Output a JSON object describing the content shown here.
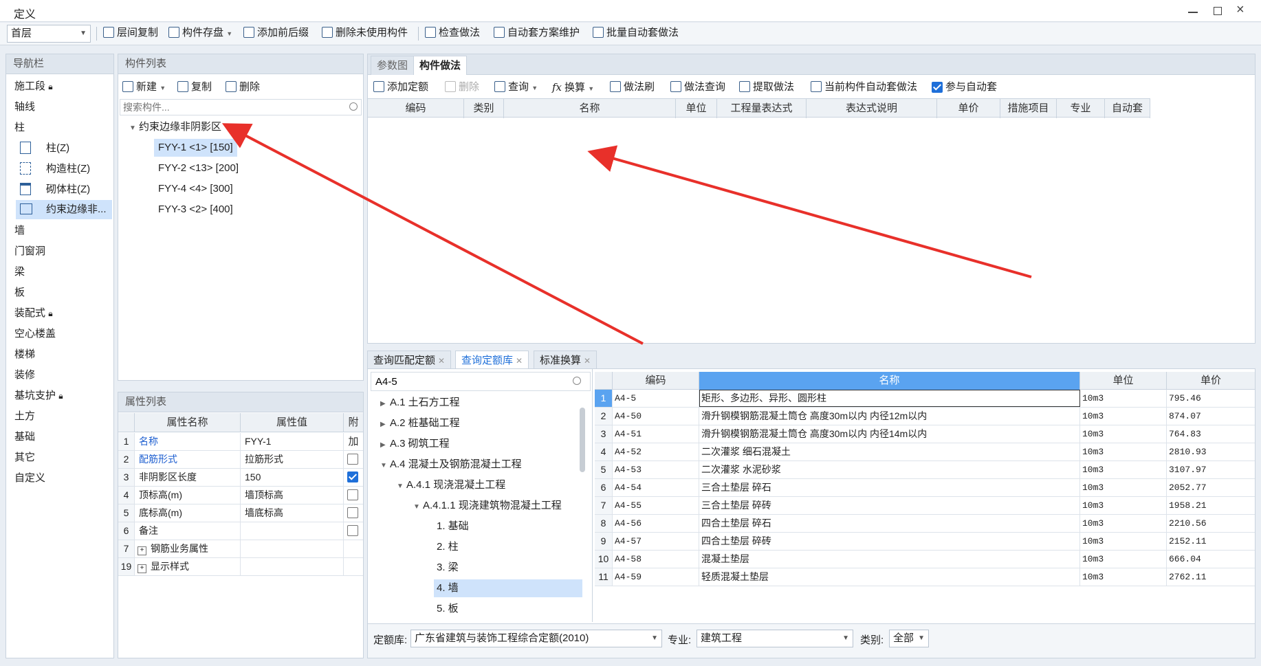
{
  "window": {
    "title": "定义"
  },
  "toolbar": {
    "floor_select": "首层",
    "items": [
      "层间复制",
      "构件存盘",
      "添加前后缀",
      "删除未使用构件",
      "检查做法",
      "自动套方案维护",
      "批量自动套做法"
    ]
  },
  "nav": {
    "title": "导航栏",
    "items": [
      "施工段",
      "轴线",
      "柱",
      "墙",
      "门窗洞",
      "梁",
      "板",
      "装配式",
      "空心楼盖",
      "楼梯",
      "装修",
      "基坑支护",
      "土方",
      "基础",
      "其它",
      "自定义"
    ],
    "sub_items": [
      "柱(Z)",
      "构造柱(Z)",
      "砌体柱(Z)",
      "约束边缘非..."
    ]
  },
  "component_list": {
    "title": "构件列表",
    "new_label": "新建",
    "copy_label": "复制",
    "delete_label": "删除",
    "search_placeholder": "搜索构件...",
    "group": "约束边缘非阴影区",
    "items": [
      "FYY-1 <1> [150]",
      "FYY-2 <13> [200]",
      "FYY-4 <4> [300]",
      "FYY-3 <2> [400]"
    ]
  },
  "properties": {
    "title": "属性列表",
    "headers": [
      "属性名称",
      "属性值",
      "附加"
    ],
    "rows": [
      {
        "no": "1",
        "name": "名称",
        "value": "FYY-1",
        "check": "none"
      },
      {
        "no": "2",
        "name": "配筋形式",
        "value": "拉筋形式",
        "check": "off"
      },
      {
        "no": "3",
        "name": "非阴影区长度",
        "value": "150",
        "check": "on"
      },
      {
        "no": "4",
        "name": "顶标高(m)",
        "value": "墙顶标高",
        "check": "off"
      },
      {
        "no": "5",
        "name": "底标高(m)",
        "value": "墙底标高",
        "check": "off"
      },
      {
        "no": "6",
        "name": "备注",
        "value": "",
        "check": "off"
      },
      {
        "no": "7",
        "name": "钢筋业务属性",
        "value": "",
        "check": "none"
      },
      {
        "no": "19",
        "name": "显示样式",
        "value": "",
        "check": "none"
      }
    ]
  },
  "method": {
    "tabs": [
      "参数图",
      "构件做法"
    ],
    "toolbar": [
      "添加定额",
      "删除",
      "查询",
      "换算",
      "做法刷",
      "做法查询",
      "提取做法",
      "当前构件自动套做法",
      "参与自动套"
    ],
    "headers": [
      "编码",
      "类别",
      "名称",
      "单位",
      "工程量表达式",
      "表达式说明",
      "单价",
      "措施项目",
      "专业",
      "自动套"
    ]
  },
  "query": {
    "tabs": [
      "查询匹配定额",
      "查询定额库",
      "标准换算"
    ],
    "search_value": "A4-5",
    "tree": [
      {
        "label": "A.1 土石方工程",
        "level": 0,
        "caret": "right"
      },
      {
        "label": "A.2 桩基础工程",
        "level": 0,
        "caret": "right"
      },
      {
        "label": "A.3 砌筑工程",
        "level": 0,
        "caret": "right"
      },
      {
        "label": "A.4 混凝土及钢筋混凝土工程",
        "level": 0,
        "caret": "down"
      },
      {
        "label": "A.4.1 现浇混凝土工程",
        "level": 1,
        "caret": "down"
      },
      {
        "label": "A.4.1.1 现浇建筑物混凝土工程",
        "level": 2,
        "caret": "down"
      },
      {
        "label": "1. 基础",
        "level": 3,
        "caret": "none"
      },
      {
        "label": "2. 柱",
        "level": 3,
        "caret": "none"
      },
      {
        "label": "3. 梁",
        "level": 3,
        "caret": "none"
      },
      {
        "label": "4. 墙",
        "level": 3,
        "caret": "none"
      },
      {
        "label": "5. 板",
        "level": 3,
        "caret": "none"
      }
    ],
    "headers": [
      "编码",
      "名称",
      "单位",
      "单价"
    ],
    "rows": [
      {
        "no": "1",
        "code": "A4-5",
        "name": "矩形、多边形、异形、圆形柱",
        "unit": "10m3",
        "price": "795.46"
      },
      {
        "no": "2",
        "code": "A4-50",
        "name": "滑升钢模钢筋混凝土筒仓 高度30m以内 内径12m以内",
        "unit": "10m3",
        "price": "874.07"
      },
      {
        "no": "3",
        "code": "A4-51",
        "name": "滑升钢模钢筋混凝土筒仓 高度30m以内 内径14m以内",
        "unit": "10m3",
        "price": "764.83"
      },
      {
        "no": "4",
        "code": "A4-52",
        "name": "二次灌浆 细石混凝土",
        "unit": "10m3",
        "price": "2810.93"
      },
      {
        "no": "5",
        "code": "A4-53",
        "name": "二次灌浆 水泥砂浆",
        "unit": "10m3",
        "price": "3107.97"
      },
      {
        "no": "6",
        "code": "A4-54",
        "name": "三合土垫层 碎石",
        "unit": "10m3",
        "price": "2052.77"
      },
      {
        "no": "7",
        "code": "A4-55",
        "name": "三合土垫层 碎砖",
        "unit": "10m3",
        "price": "1958.21"
      },
      {
        "no": "8",
        "code": "A4-56",
        "name": "四合土垫层 碎石",
        "unit": "10m3",
        "price": "2210.56"
      },
      {
        "no": "9",
        "code": "A4-57",
        "name": "四合土垫层 碎砖",
        "unit": "10m3",
        "price": "2152.11"
      },
      {
        "no": "10",
        "code": "A4-58",
        "name": "混凝土垫层",
        "unit": "10m3",
        "price": "666.04"
      },
      {
        "no": "11",
        "code": "A4-59",
        "name": "轻质混凝土垫层",
        "unit": "10m3",
        "price": "2762.11"
      }
    ],
    "footer": {
      "lib_label": "定额库:",
      "lib_value": "广东省建筑与装饰工程综合定额(2010)",
      "major_label": "专业:",
      "major_value": "建筑工程",
      "type_label": "类别:",
      "type_value": "全部"
    }
  },
  "colors": {
    "accent": "#1e6fd9",
    "arrow": "#e8302a",
    "selected_bg": "#cfe3fb"
  }
}
